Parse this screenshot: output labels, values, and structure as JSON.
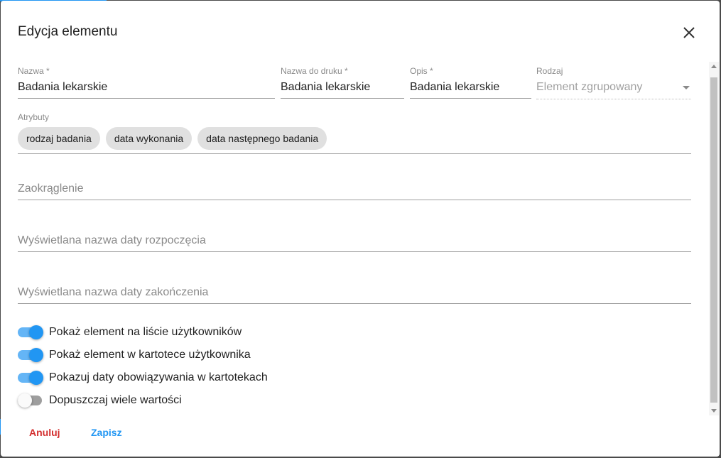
{
  "dialog": {
    "title": "Edycja elementu",
    "close_icon": "close-icon"
  },
  "fields": {
    "nazwa": {
      "label": "Nazwa *",
      "value": "Badania lekarskie"
    },
    "nazwa_druk": {
      "label": "Nazwa do druku *",
      "value": "Badania lekarskie"
    },
    "opis": {
      "label": "Opis *",
      "value": "Badania lekarskie"
    },
    "rodzaj": {
      "label": "Rodzaj",
      "value": "Element zgrupowany",
      "icon": "chevron-down-icon"
    }
  },
  "atrybuty": {
    "label": "Atrybuty",
    "chips": [
      "rodzaj badania",
      "data wykonania",
      "data następnego badania"
    ]
  },
  "zaokraglenie": {
    "placeholder": "Zaokrąglenie"
  },
  "data_rozpoczecia": {
    "placeholder": "Wyświetlana nazwa daty rozpoczęcia"
  },
  "data_zakonczenia": {
    "placeholder": "Wyświetlana nazwa daty zakończenia"
  },
  "switches": [
    {
      "label": "Pokaż element na liście użytkowników",
      "checked": true
    },
    {
      "label": "Pokaż element w kartotece użytkownika",
      "checked": true
    },
    {
      "label": "Pokazuj daty obowiązywania w kartotekach",
      "checked": true
    },
    {
      "label": "Dopuszczaj wiele wartości",
      "checked": false
    }
  ],
  "actions": {
    "cancel": "Anuluj",
    "save": "Zapisz"
  },
  "colors": {
    "accent": "#2196f3",
    "danger": "#d32f2f",
    "chip_bg": "#e0e0e0"
  }
}
